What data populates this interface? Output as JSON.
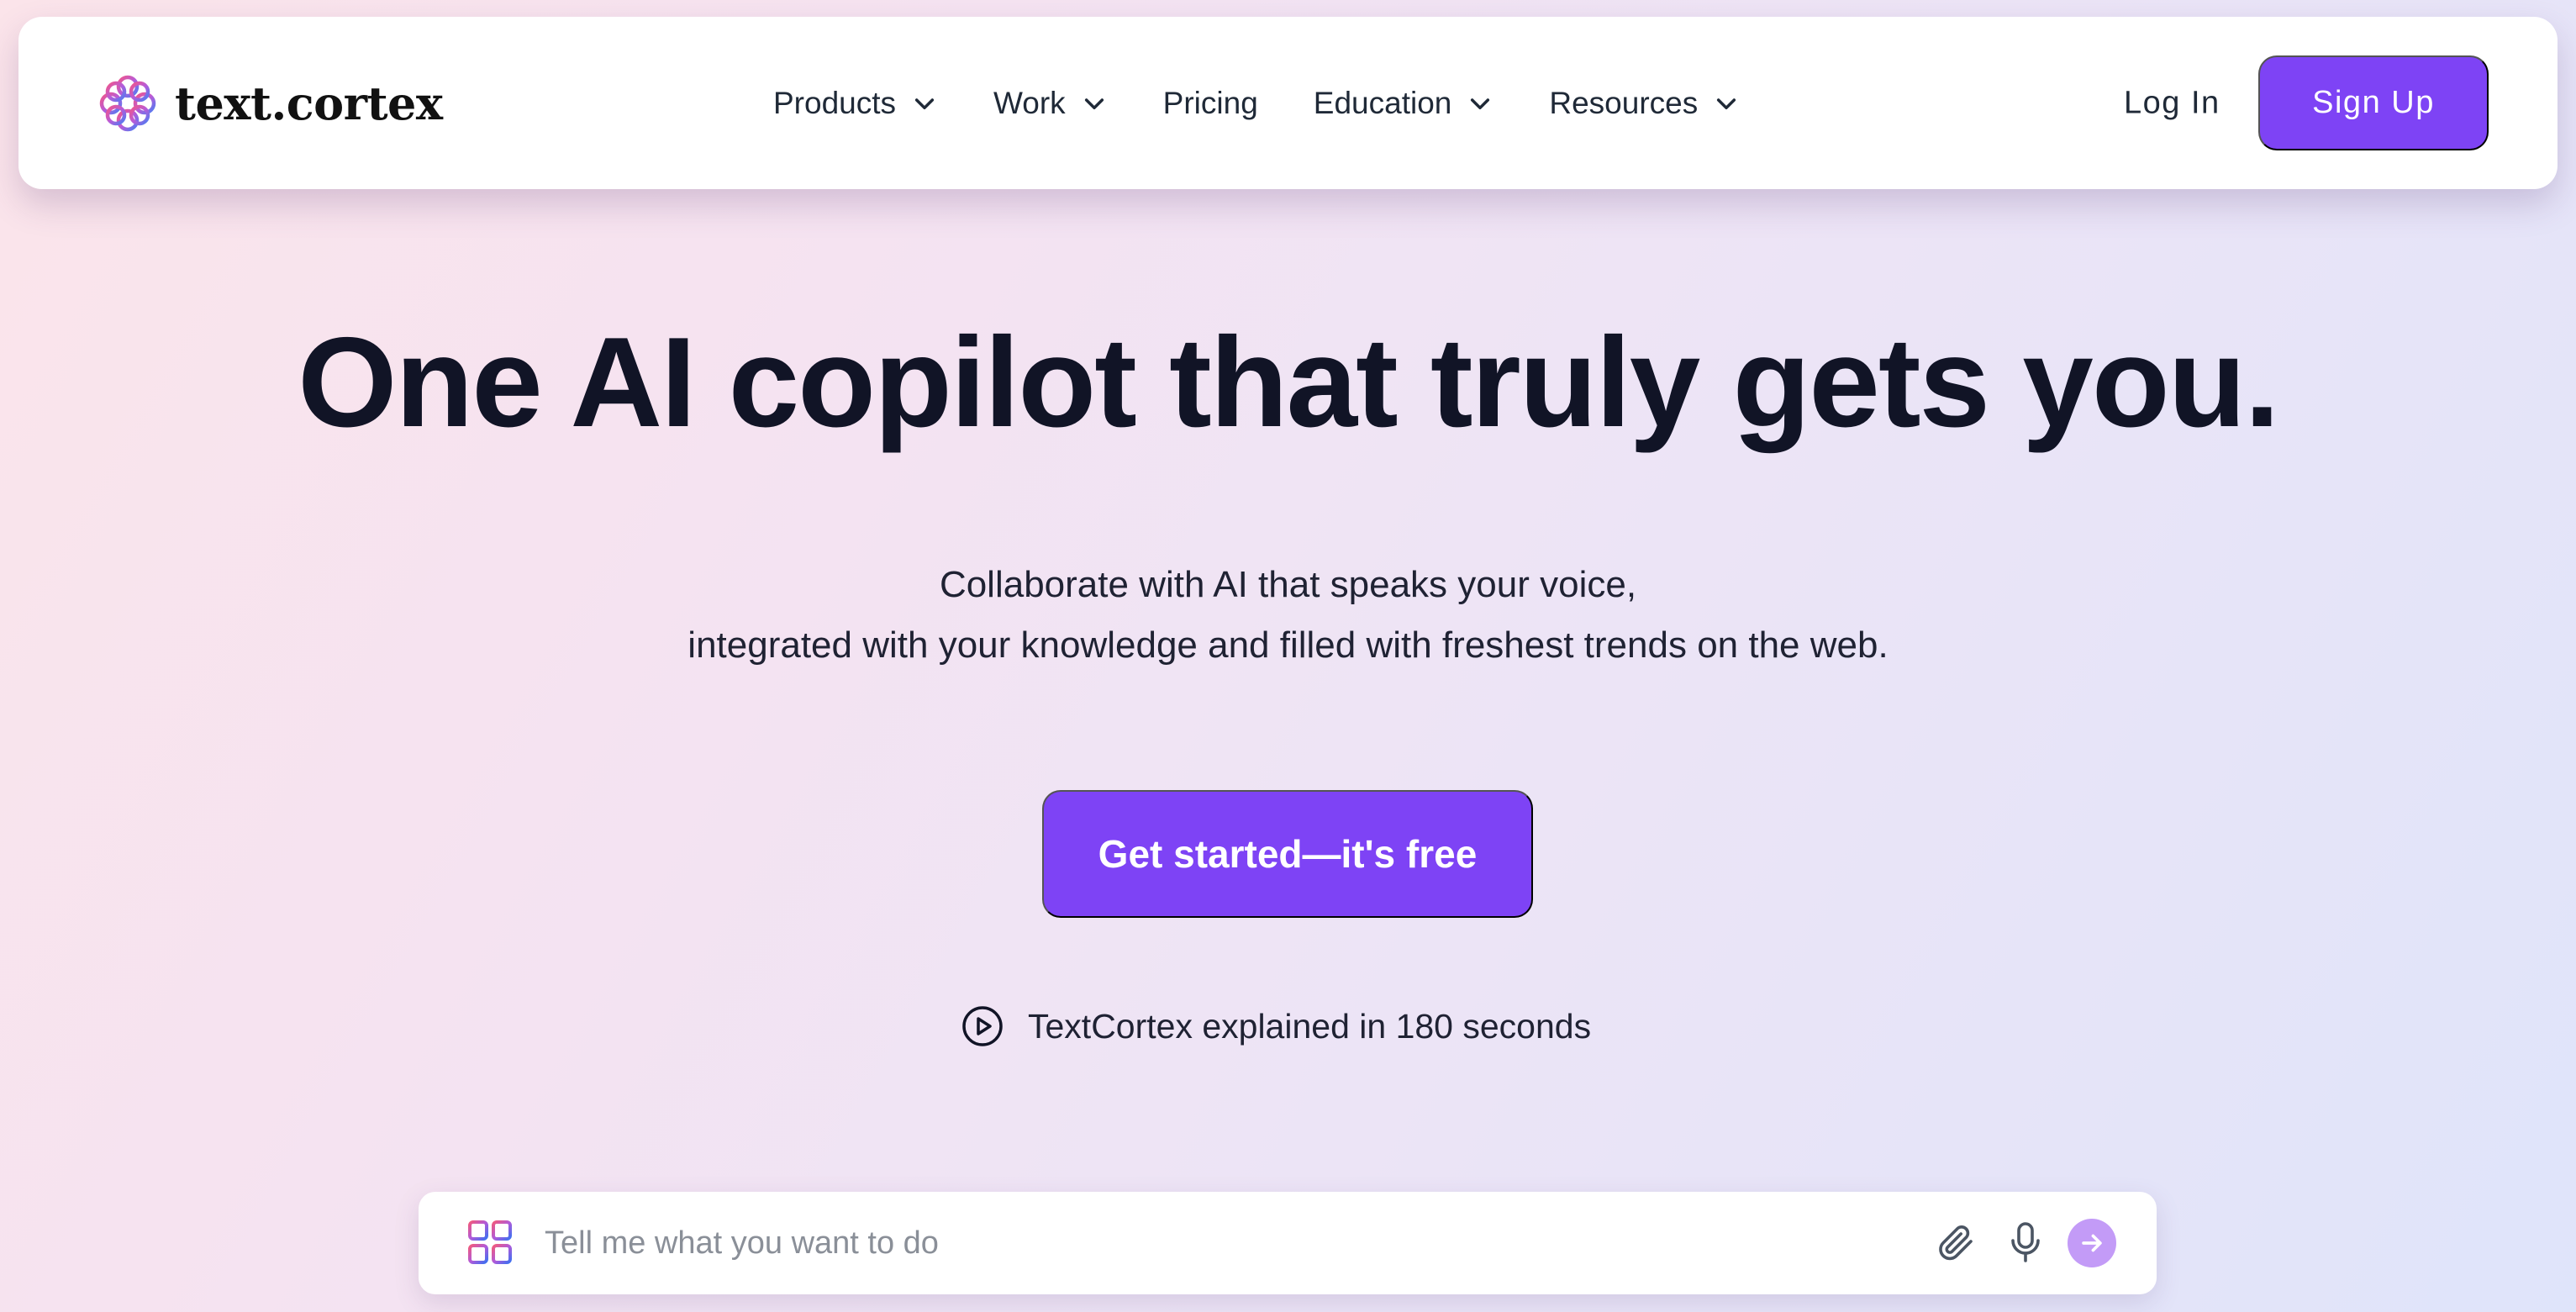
{
  "brand": {
    "name": "text.cortex",
    "logo_icon": "flower-logo-icon"
  },
  "nav": {
    "items": [
      {
        "label": "Products",
        "has_dropdown": true
      },
      {
        "label": "Work",
        "has_dropdown": true
      },
      {
        "label": "Pricing",
        "has_dropdown": false
      },
      {
        "label": "Education",
        "has_dropdown": true
      },
      {
        "label": "Resources",
        "has_dropdown": true
      }
    ],
    "login_label": "Log In",
    "signup_label": "Sign Up"
  },
  "hero": {
    "headline": "One AI copilot that truly gets you.",
    "subtitle_line1": "Collaborate with AI that speaks your voice,",
    "subtitle_line2": "integrated with your knowledge and filled with freshest trends on the web.",
    "cta_label": "Get started—it's free",
    "video_link_label": "TextCortex explained in 180 seconds"
  },
  "prompt_bar": {
    "placeholder": "Tell me what you want to do",
    "value": "",
    "icons": [
      "apps-grid-icon",
      "paperclip-icon",
      "microphone-icon",
      "arrow-right-icon"
    ]
  },
  "colors": {
    "accent": "#7e43f5",
    "send_button": "#c39bf7",
    "headline": "#111426",
    "background_start": "#fbe4ea",
    "background_end": "#dfe4fa"
  }
}
